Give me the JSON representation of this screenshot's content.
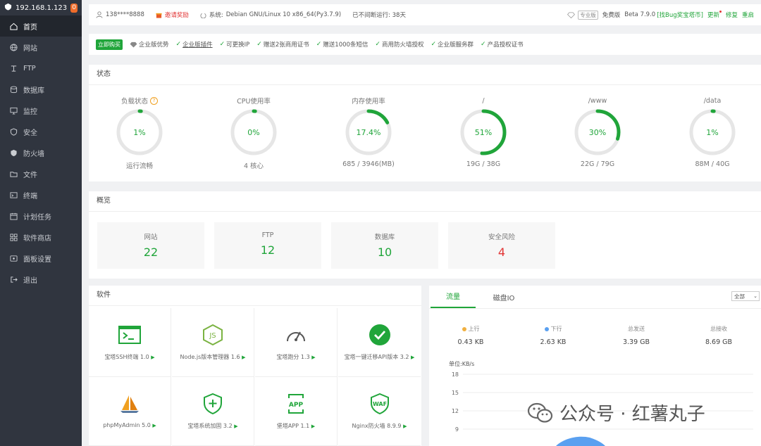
{
  "sidebar": {
    "host": "192.168.1.123",
    "badge": "0",
    "items": [
      {
        "label": "首页",
        "icon": "home-icon",
        "active": true
      },
      {
        "label": "网站",
        "icon": "globe-icon"
      },
      {
        "label": "FTP",
        "icon": "ftp-icon"
      },
      {
        "label": "数据库",
        "icon": "database-icon"
      },
      {
        "label": "监控",
        "icon": "monitor-icon"
      },
      {
        "label": "安全",
        "icon": "shield-icon"
      },
      {
        "label": "防火墙",
        "icon": "firewall-icon"
      },
      {
        "label": "文件",
        "icon": "folder-icon"
      },
      {
        "label": "终端",
        "icon": "terminal-icon"
      },
      {
        "label": "计划任务",
        "icon": "calendar-icon"
      },
      {
        "label": "软件商店",
        "icon": "apps-icon"
      },
      {
        "label": "面板设置",
        "icon": "settings-icon"
      },
      {
        "label": "退出",
        "icon": "logout-icon"
      }
    ]
  },
  "topbar": {
    "user": "138****8888",
    "invite": "邀请奖励",
    "system_label": "系统:",
    "system": "Debian GNU/Linux 10 x86_64(Py3.7.9)",
    "uptime": "已不间断运行: 38天",
    "pro_tag": "专业版",
    "edition": "免费版",
    "version": "Beta 7.9.0",
    "bug_reward": "[找Bug奖宝塔币]",
    "update": "更新",
    "repair": "修复",
    "restart": "重启"
  },
  "enterprise": {
    "buy": "立即购买",
    "advantage": "企业版优势",
    "items": [
      "企业版插件",
      "可更换IP",
      "赠送2张商用证书",
      "赠送1000条短信",
      "商用防火墙授权",
      "企业版服务群",
      "产品授权证书"
    ]
  },
  "status": {
    "title": "状态",
    "gauges": [
      {
        "label": "负载状态",
        "value": "1%",
        "percent": 1,
        "sub": "运行流畅",
        "help": "?"
      },
      {
        "label": "CPU使用率",
        "value": "0%",
        "percent": 0,
        "sub": "4 核心"
      },
      {
        "label": "内存使用率",
        "value": "17.4%",
        "percent": 17.4,
        "sub": "685 / 3946(MB)"
      },
      {
        "label": "/",
        "value": "51%",
        "percent": 51,
        "sub": "19G / 38G"
      },
      {
        "label": "/www",
        "value": "30%",
        "percent": 30,
        "sub": "22G / 79G"
      },
      {
        "label": "/data",
        "value": "1%",
        "percent": 1,
        "sub": "88M / 40G"
      }
    ]
  },
  "overview": {
    "title": "概览",
    "cards": [
      {
        "label": "网站",
        "value": "22"
      },
      {
        "label": "FTP",
        "value": "12"
      },
      {
        "label": "数据库",
        "value": "10"
      },
      {
        "label": "安全风险",
        "value": "4",
        "danger": true
      }
    ]
  },
  "software": {
    "title": "软件",
    "items": [
      {
        "name": "宝塔SSH终端 1.0",
        "icon": "ssh-terminal-icon"
      },
      {
        "name": "Node.js版本管理器 1.6",
        "icon": "nodejs-icon"
      },
      {
        "name": "宝塔跑分 1.3",
        "icon": "speedometer-icon"
      },
      {
        "name": "宝塔一键迁移API版本 3.2",
        "icon": "check-circle-icon"
      },
      {
        "name": "phpMyAdmin 5.0",
        "icon": "phpmyadmin-icon"
      },
      {
        "name": "宝塔系统加固 3.2",
        "icon": "shield-plus-icon"
      },
      {
        "name": "堡塔APP 1.1",
        "icon": "app-icon"
      },
      {
        "name": "Nginx防火墙 8.9.9",
        "icon": "waf-icon"
      }
    ],
    "arrow": "▶"
  },
  "network": {
    "tabs": [
      "流量",
      "磁盘IO"
    ],
    "select": "全部",
    "stats": [
      {
        "label": "上行",
        "value": "0.43 KB",
        "dot": "#f0b040"
      },
      {
        "label": "下行",
        "value": "2.63 KB",
        "dot": "#5aa0f0"
      },
      {
        "label": "总发送",
        "value": "3.39 GB"
      },
      {
        "label": "总接收",
        "value": "8.69 GB"
      }
    ],
    "unit": "单位:KB/s"
  },
  "chart_data": {
    "type": "area",
    "ylabel": "单位:KB/s",
    "y_ticks": [
      18,
      15,
      12,
      9
    ],
    "ylim": [
      0,
      18
    ],
    "x": [],
    "series": []
  },
  "watermark": "公众号 · 红薯丸子",
  "colors": {
    "accent": "#20a53a",
    "danger": "#e23434",
    "sidebar": "#30353f"
  }
}
